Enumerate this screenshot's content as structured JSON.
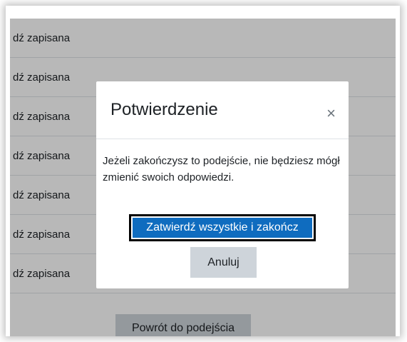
{
  "rows": [
    "dź zapisana",
    "dź zapisana",
    "dź zapisana",
    "dź zapisana",
    "dź zapisana",
    "dź zapisana",
    "dź zapisana"
  ],
  "footer": {
    "return_label": "Powrót do podejścia"
  },
  "modal": {
    "title": "Potwierdzenie",
    "close_icon": "close-icon",
    "close_glyph": "×",
    "body": "Jeżeli zakończysz to podejście, nie będziesz mógł zmienić swoich odpowiedzi.",
    "confirm_label": "Zatwierdź wszystkie i zakończ",
    "cancel_label": "Anuluj"
  },
  "colors": {
    "primary": "#0f6cbf",
    "secondary": "#ced4da",
    "text": "#1d2125"
  }
}
